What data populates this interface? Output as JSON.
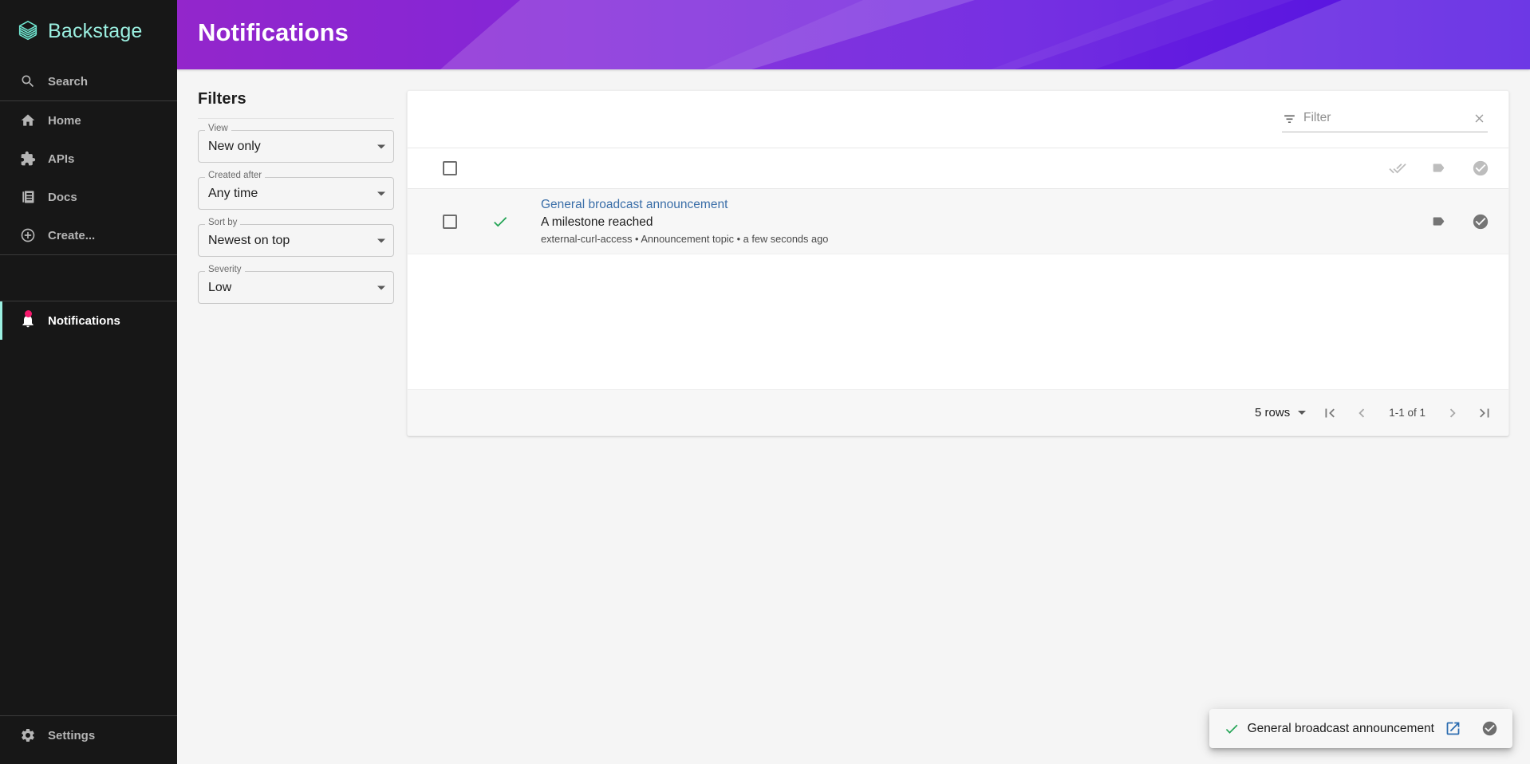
{
  "brand": {
    "name": "Backstage",
    "logo_icon": "backstage-logo-icon",
    "accent_color": "#9BF0E1"
  },
  "sidebar": {
    "search": {
      "label": "Search",
      "icon": "search-icon"
    },
    "items": [
      {
        "label": "Home",
        "icon": "home-icon",
        "active": false
      },
      {
        "label": "APIs",
        "icon": "puzzle-piece-icon",
        "active": false
      },
      {
        "label": "Docs",
        "icon": "docs-icon",
        "active": false
      },
      {
        "label": "Create...",
        "icon": "plus-circle-icon",
        "active": false
      }
    ],
    "notifications": {
      "label": "Notifications",
      "icon": "bell-icon",
      "active": true,
      "badge": true,
      "badge_color": "#f5186c"
    },
    "settings": {
      "label": "Settings",
      "icon": "gear-icon",
      "active": false
    }
  },
  "header": {
    "title": "Notifications",
    "gradient_from": "#9326CB",
    "gradient_to": "#5010E0"
  },
  "filters": {
    "title": "Filters",
    "fields": [
      {
        "label": "View",
        "value": "New only"
      },
      {
        "label": "Created after",
        "value": "Any time"
      },
      {
        "label": "Sort by",
        "value": "Newest on top"
      },
      {
        "label": "Severity",
        "value": "Low"
      }
    ]
  },
  "table": {
    "search": {
      "placeholder": "Filter",
      "value": "",
      "icon": "filter-list-icon",
      "clear_icon": "close-icon"
    },
    "header_actions": [
      {
        "name": "mark-all-read-button",
        "icon": "done-all-icon"
      },
      {
        "name": "mark-all-saved-button",
        "icon": "tag-icon"
      },
      {
        "name": "mark-all-done-button",
        "icon": "check-circle-icon"
      }
    ],
    "select_all_checkbox": {
      "checked": false
    },
    "rows": [
      {
        "checked": false,
        "status_icon": "check-icon",
        "status_color": "#23A455",
        "title": "General broadcast announcement",
        "description": "A milestone reached",
        "meta": "external-curl-access • Announcement topic • a few seconds ago",
        "actions": [
          {
            "name": "save-notification-button",
            "icon": "tag-icon"
          },
          {
            "name": "mark-done-button",
            "icon": "check-circle-icon"
          }
        ]
      }
    ],
    "pagination": {
      "rows_per_page": "5 rows",
      "range": "1-1 of 1",
      "first_icon": "first-page-icon",
      "prev_icon": "chevron-left-icon",
      "next_icon": "chevron-right-icon",
      "last_icon": "last-page-icon"
    }
  },
  "toast": {
    "status_icon": "check-icon",
    "message": "General broadcast announcement",
    "actions": [
      {
        "name": "open-in-new-button",
        "icon": "open-in-new-icon",
        "color": "#2b6cb0"
      },
      {
        "name": "mark-done-button",
        "icon": "check-circle-icon",
        "color": "#6e6e6e"
      }
    ]
  }
}
